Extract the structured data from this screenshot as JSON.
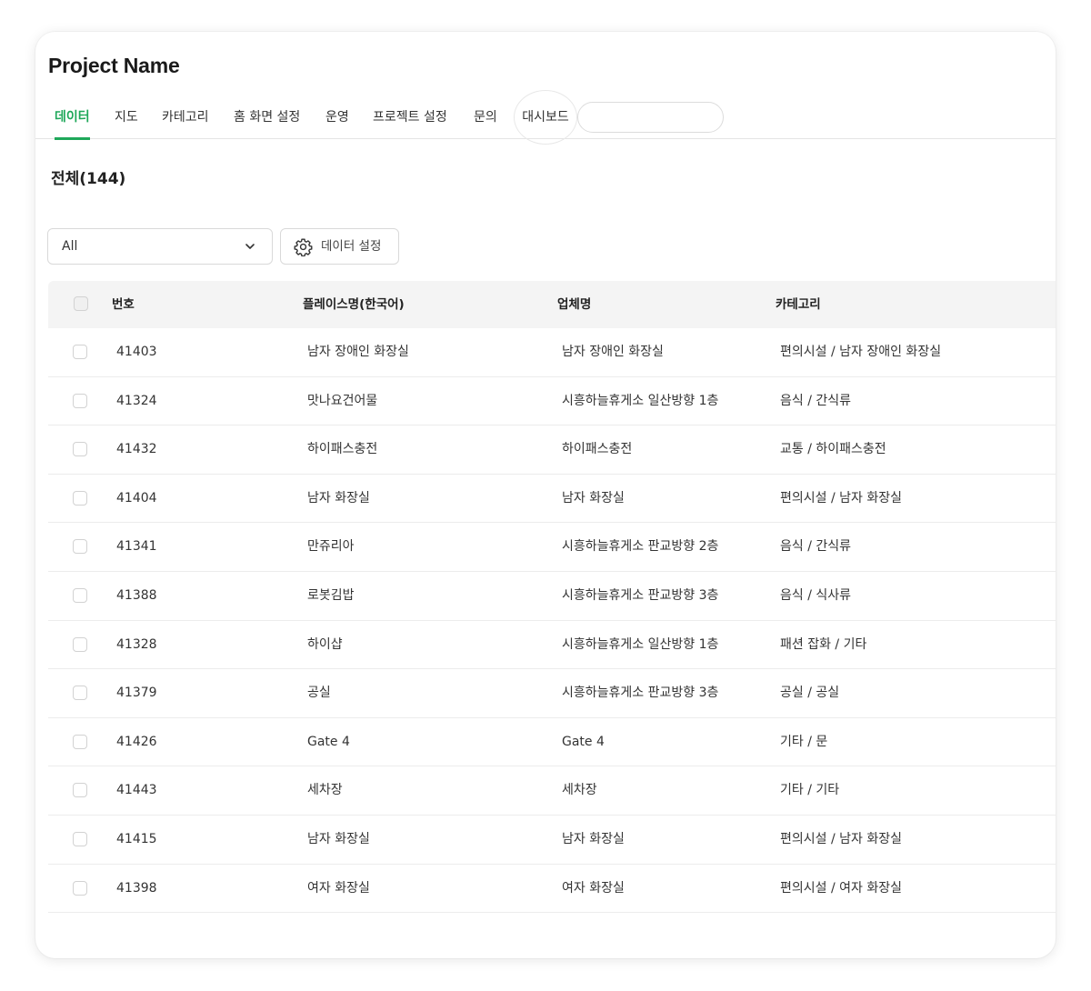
{
  "project": {
    "title": "Project Name"
  },
  "tabs": [
    {
      "label": "데이터",
      "active": true
    },
    {
      "label": "지도"
    },
    {
      "label": "카테고리"
    },
    {
      "label": "홈 화면 설정"
    },
    {
      "label": "운영"
    },
    {
      "label": "프로젝트 설정"
    },
    {
      "label": "문의"
    },
    {
      "label": "대시보드"
    }
  ],
  "search": {
    "value": "",
    "placeholder": ""
  },
  "summary": {
    "count_label": "전체(144)"
  },
  "filter": {
    "selected": "All"
  },
  "toolbar": {
    "settings_label": "데이터 설정"
  },
  "table": {
    "columns": [
      "번호",
      "플레이스명(한국어)",
      "업체명",
      "카테고리"
    ],
    "rows": [
      {
        "id": "41403",
        "place": "남자 장애인 화장실",
        "business": "남자 장애인 화장실",
        "category": "편의시설 / 남자 장애인 화장실"
      },
      {
        "id": "41324",
        "place": "맛나요건어물",
        "business": "시흥하늘휴게소 일산방향 1층",
        "category": "음식 / 간식류"
      },
      {
        "id": "41432",
        "place": "하이패스충전",
        "business": "하이패스충전",
        "category": "교통 / 하이패스충전"
      },
      {
        "id": "41404",
        "place": "남자 화장실",
        "business": "남자 화장실",
        "category": "편의시설 / 남자 화장실"
      },
      {
        "id": "41341",
        "place": "만쥬리아",
        "business": "시흥하늘휴게소 판교방향 2층",
        "category": "음식 / 간식류"
      },
      {
        "id": "41388",
        "place": "로봇김밥",
        "business": "시흥하늘휴게소 판교방향 3층",
        "category": "음식 / 식사류"
      },
      {
        "id": "41328",
        "place": "하이샵",
        "business": "시흥하늘휴게소 일산방향 1층",
        "category": "패션 잡화 / 기타"
      },
      {
        "id": "41379",
        "place": "공실",
        "business": "시흥하늘휴게소 판교방향 3층",
        "category": "공실 / 공실"
      },
      {
        "id": "41426",
        "place": "Gate 4",
        "business": "Gate 4",
        "category": "기타 / 문"
      },
      {
        "id": "41443",
        "place": "세차장",
        "business": "세차장",
        "category": "기타 / 기타"
      },
      {
        "id": "41415",
        "place": "남자 화장실",
        "business": "남자 화장실",
        "category": "편의시설 / 남자 화장실"
      },
      {
        "id": "41398",
        "place": "여자 화장실",
        "business": "여자 화장실",
        "category": "편의시설 / 여자 화장실"
      }
    ]
  },
  "colors": {
    "accent": "#1fa85a",
    "header_bg": "#f4f4f4"
  },
  "icons": {
    "filter_chevron": "chevron-down-icon",
    "settings": "gear-icon"
  }
}
